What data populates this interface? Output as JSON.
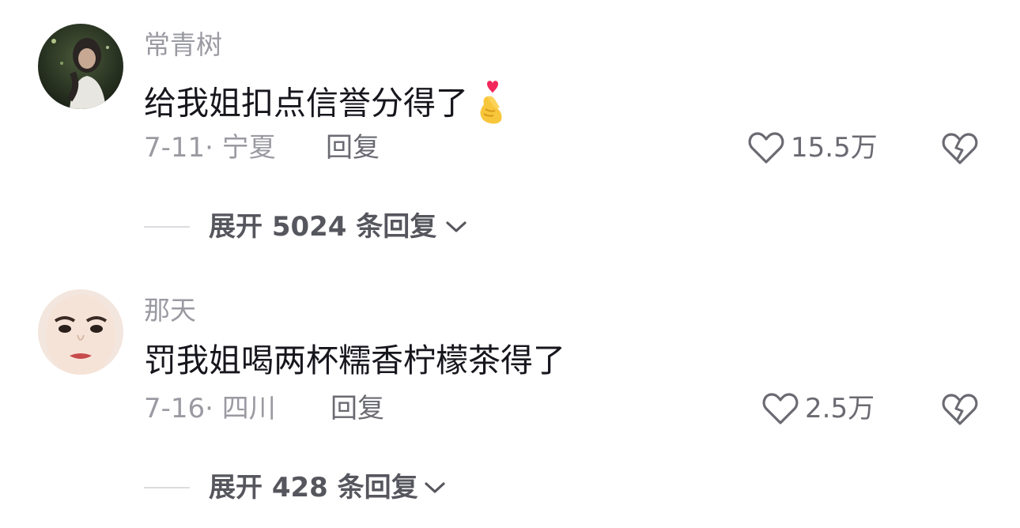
{
  "comments": [
    {
      "username": "常青树",
      "content": "给我姐扣点信誉分得了",
      "date_region": "7-11· 宁夏",
      "reply_label": "回复",
      "likes": "15.5万",
      "expand_label": "展开 5024 条回复",
      "avatar": "avatar-photo-woman-night",
      "emoji": "finger-heart-emoji"
    },
    {
      "username": "那天",
      "content": "罚我姐喝两杯糯香柠檬茶得了",
      "date_region": "7-16· 四川",
      "reply_label": "回复",
      "likes": "2.5万",
      "expand_label": "展开 428 条回复",
      "avatar": "avatar-photo-face-closeup"
    }
  ],
  "icons": {
    "like": "heart-outline-icon",
    "dislike": "broken-heart-icon",
    "expand": "chevron-down-icon"
  },
  "colors": {
    "text_primary": "#16161d",
    "text_secondary": "#9a9aa2",
    "text_action": "#6a6a72",
    "divider": "#dcdce0"
  }
}
